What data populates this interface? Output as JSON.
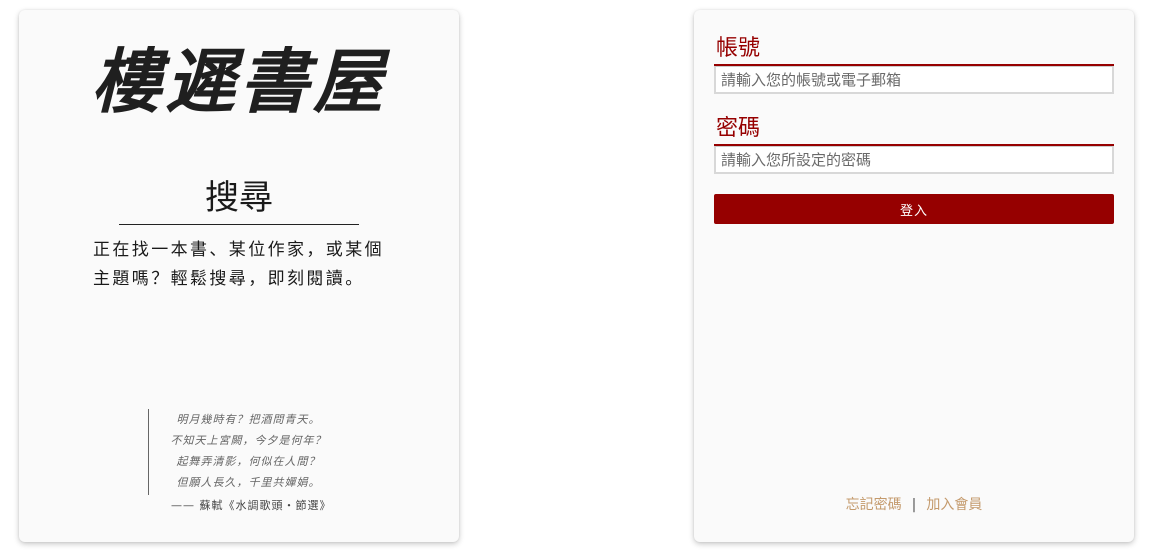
{
  "brand": {
    "logo_text": "樓遲書屋"
  },
  "search_panel": {
    "title": "搜尋",
    "description": "正在找一本書、某位作家，或某個主題嗎？輕鬆搜尋，即刻閱讀。"
  },
  "poem": {
    "lines": [
      "明月幾時有？把酒問青天。",
      "不知天上宮闕，今夕是何年？",
      "起舞弄清影，何似在人間？",
      "但願人長久，千里共嬋娟。"
    ],
    "source": "—— 蘇軾《水調歌頭・節選》"
  },
  "login": {
    "account_label": "帳號",
    "account_placeholder": "請輸入您的帳號或電子郵箱",
    "password_label": "密碼",
    "password_placeholder": "請輸入您所設定的密碼",
    "submit_label": "登入"
  },
  "footer_links": {
    "forgot_password": "忘記密碼",
    "separator": "|",
    "join_member": "加入會員"
  },
  "colors": {
    "accent": "#960000",
    "link": "#c49a6c"
  }
}
